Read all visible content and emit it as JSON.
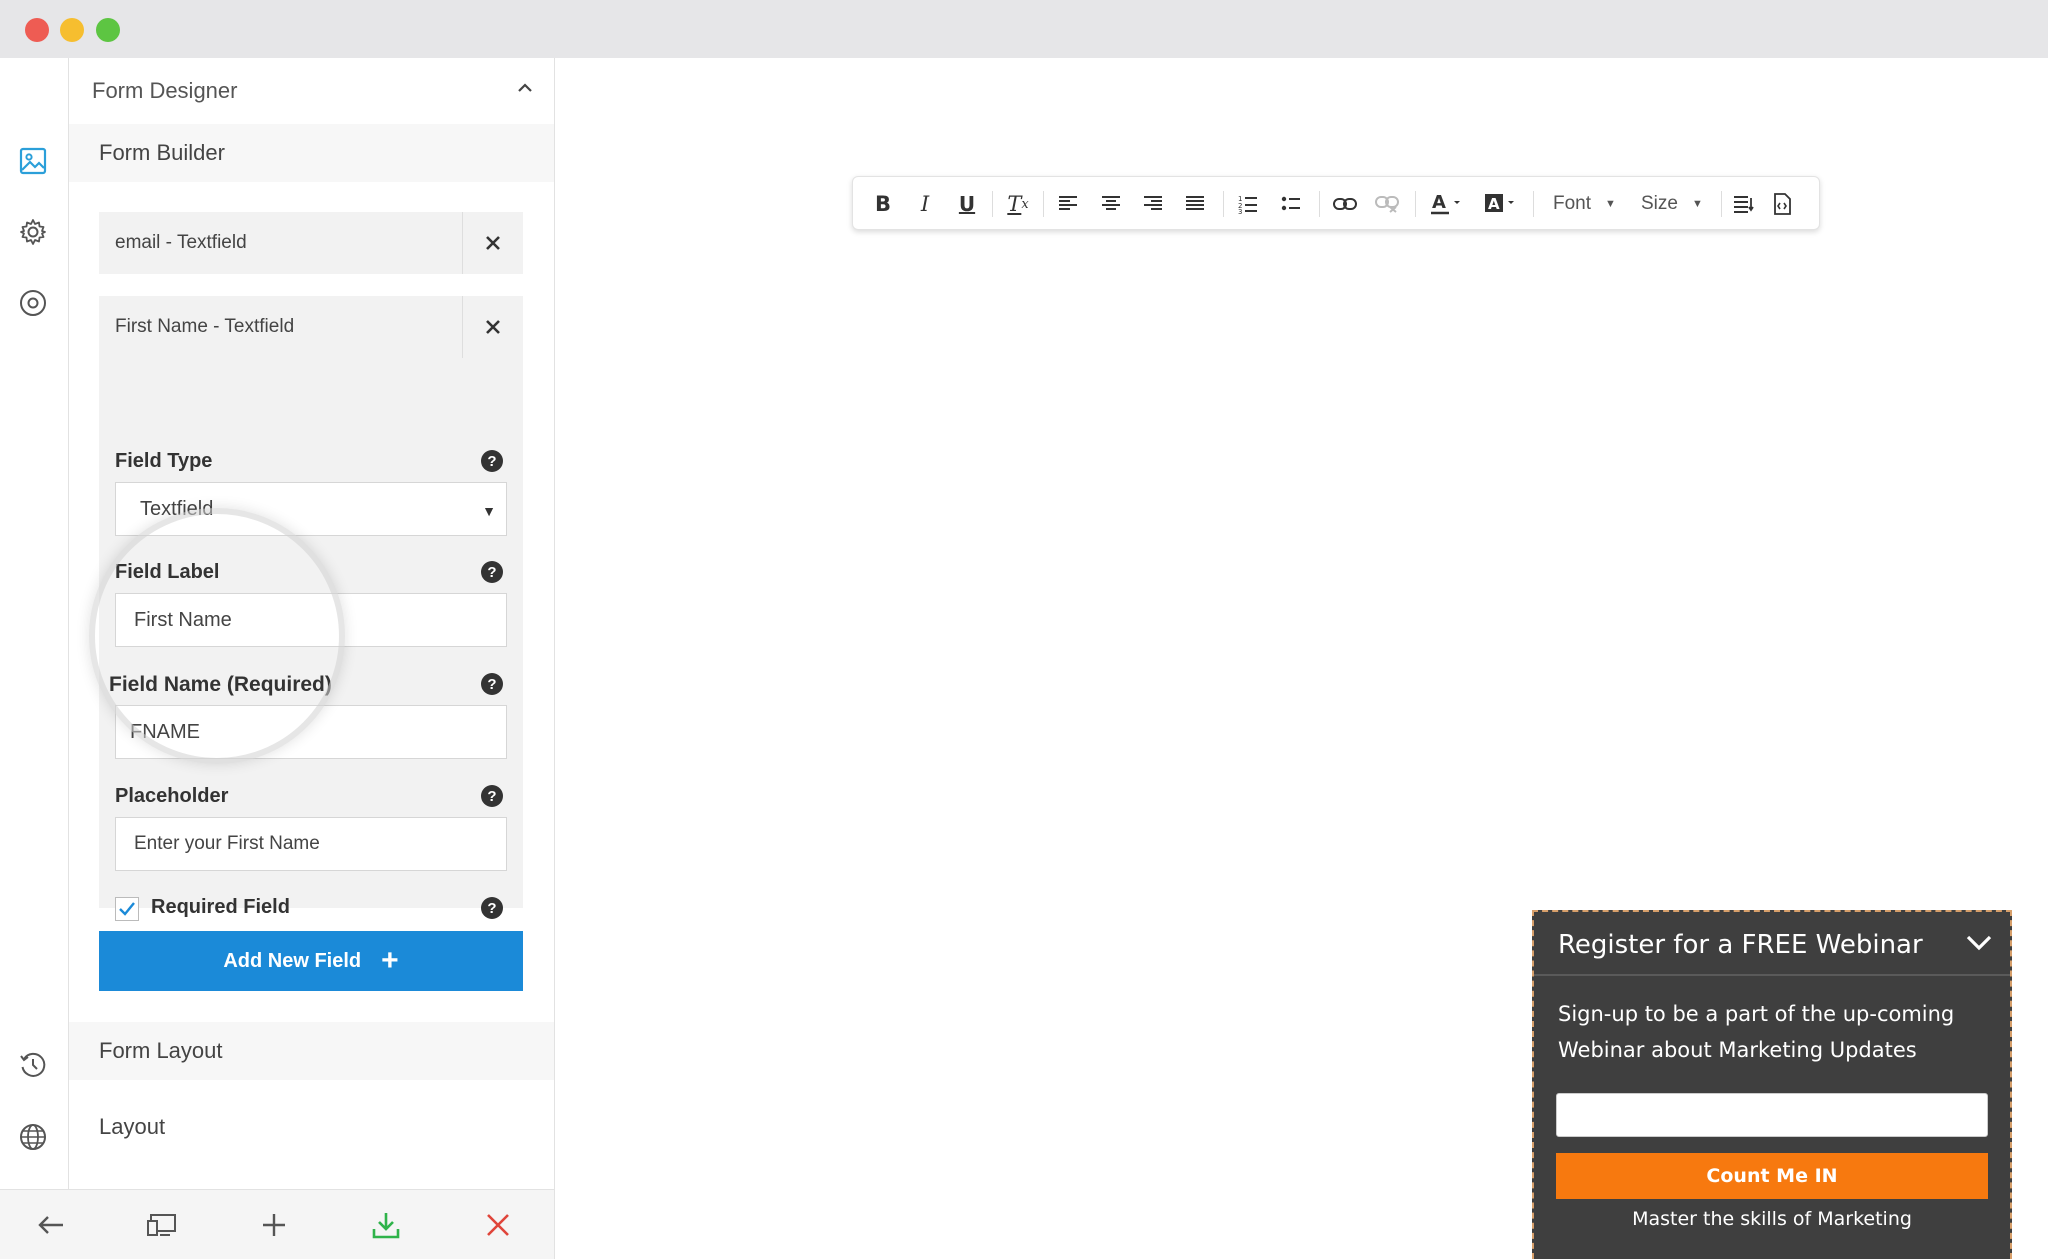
{
  "window": {
    "controls": [
      "close",
      "minimize",
      "maximize"
    ]
  },
  "rail": {
    "icons": [
      "image-icon",
      "gear-icon",
      "target-icon",
      "history-icon",
      "globe-icon"
    ]
  },
  "panel": {
    "title": "Form Designer",
    "section_builder": "Form Builder",
    "fields": [
      {
        "label": "email - Textfield"
      },
      {
        "label": "First Name - Textfield"
      }
    ],
    "editor": {
      "field_type_label": "Field Type",
      "field_type_value": "Textfield",
      "field_label_label": "Field Label",
      "field_label_value": "First Name",
      "field_name_label": "Field Name (Required)",
      "field_name_value": "FNAME",
      "placeholder_label": "Placeholder",
      "placeholder_value": "Enter your First Name",
      "required_label": "Required Field",
      "required_checked": true,
      "help_glyph": "?"
    },
    "add_button": "Add New Field",
    "add_button_plus": "+",
    "section_layout": "Form Layout",
    "section_layout2": "Layout"
  },
  "bottom_bar": {
    "icons": [
      "back-arrow-icon",
      "devices-icon",
      "plus-icon",
      "download-icon",
      "close-icon"
    ],
    "colors": {
      "download": "#2fb34a",
      "close": "#e0453a"
    }
  },
  "editor_toolbar": {
    "font_label": "Font",
    "size_label": "Size",
    "buttons": [
      "bold",
      "italic",
      "underline",
      "clear-format",
      "align-left",
      "align-center",
      "align-right",
      "align-justify",
      "ordered-list",
      "unordered-list",
      "link",
      "unlink",
      "text-color",
      "background-color",
      "font",
      "size",
      "paragraph",
      "source"
    ]
  },
  "webinar": {
    "title": "Register for a FREE Webinar",
    "description": "Sign-up to be a part of the up-coming Webinar about Marketing Updates",
    "button": "Count Me IN",
    "footer": "Master the skills of Marketing",
    "colors": {
      "background": "#3f3f3f",
      "button": "#f7790f"
    }
  },
  "colors": {
    "accent": "#1b8ad8",
    "rail_icon_active": "#2b9fd9"
  }
}
